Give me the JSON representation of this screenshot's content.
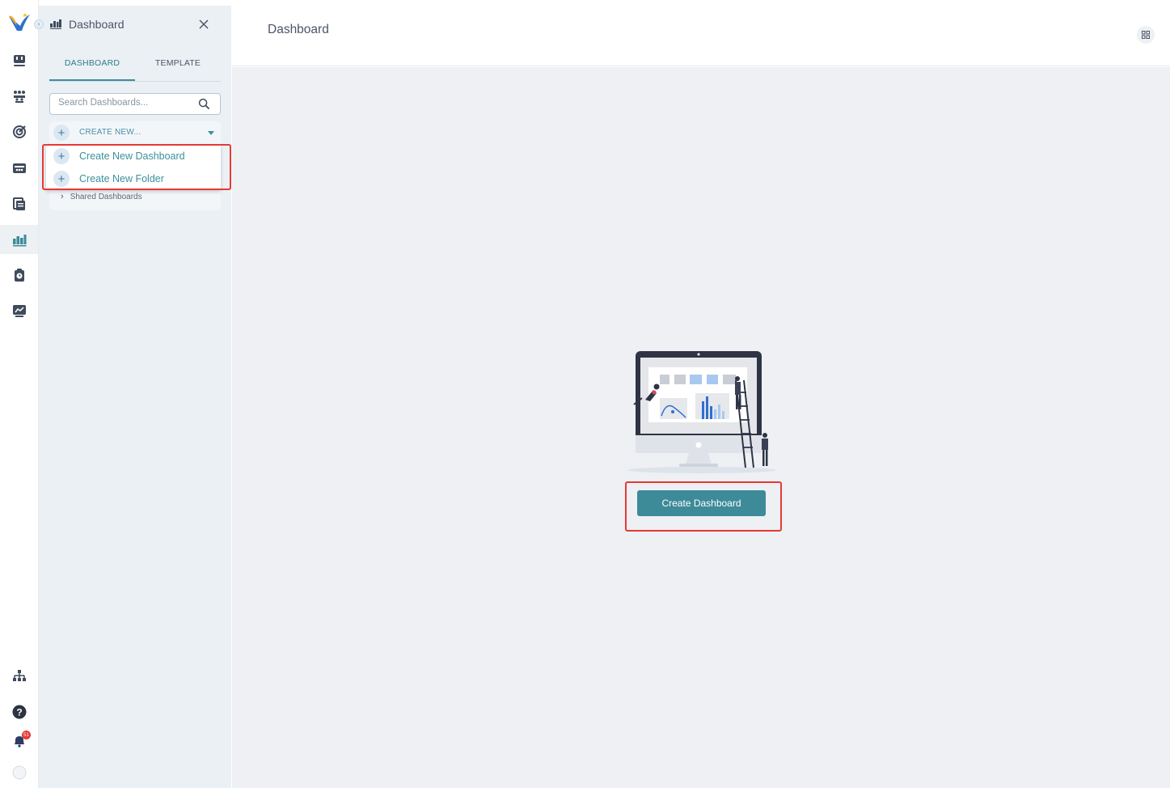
{
  "rail": {
    "logo_icon": "app-logo-icon",
    "items": [
      {
        "icon": "board-icon"
      },
      {
        "icon": "team-icon"
      },
      {
        "icon": "target-icon"
      },
      {
        "icon": "inbox-icon"
      },
      {
        "icon": "documents-icon"
      },
      {
        "icon": "dashboard-icon",
        "active": true
      },
      {
        "icon": "timesheet-icon"
      },
      {
        "icon": "reports-icon"
      }
    ],
    "bottom": [
      {
        "icon": "org-chart-icon"
      },
      {
        "icon": "help-icon"
      },
      {
        "icon": "bell-icon",
        "badge": "51"
      },
      {
        "icon": "avatar-icon"
      }
    ]
  },
  "panel": {
    "title": "Dashboard",
    "tabs": [
      {
        "label": "DASHBOARD",
        "active": true
      },
      {
        "label": "TEMPLATE"
      }
    ],
    "search_placeholder": "Search Dashboards...",
    "create_new_label": "CREATE NEW...",
    "dropdown": [
      {
        "label": "Create New Dashboard"
      },
      {
        "label": "Create New Folder"
      }
    ],
    "shared_label": "Shared Dashboards"
  },
  "main": {
    "title": "Dashboard",
    "create_button": "Create Dashboard"
  },
  "colors": {
    "accent": "#3d8a98",
    "highlight": "#e53935",
    "panel_bg": "#ebf0f5",
    "content_bg": "#eef0f3"
  }
}
